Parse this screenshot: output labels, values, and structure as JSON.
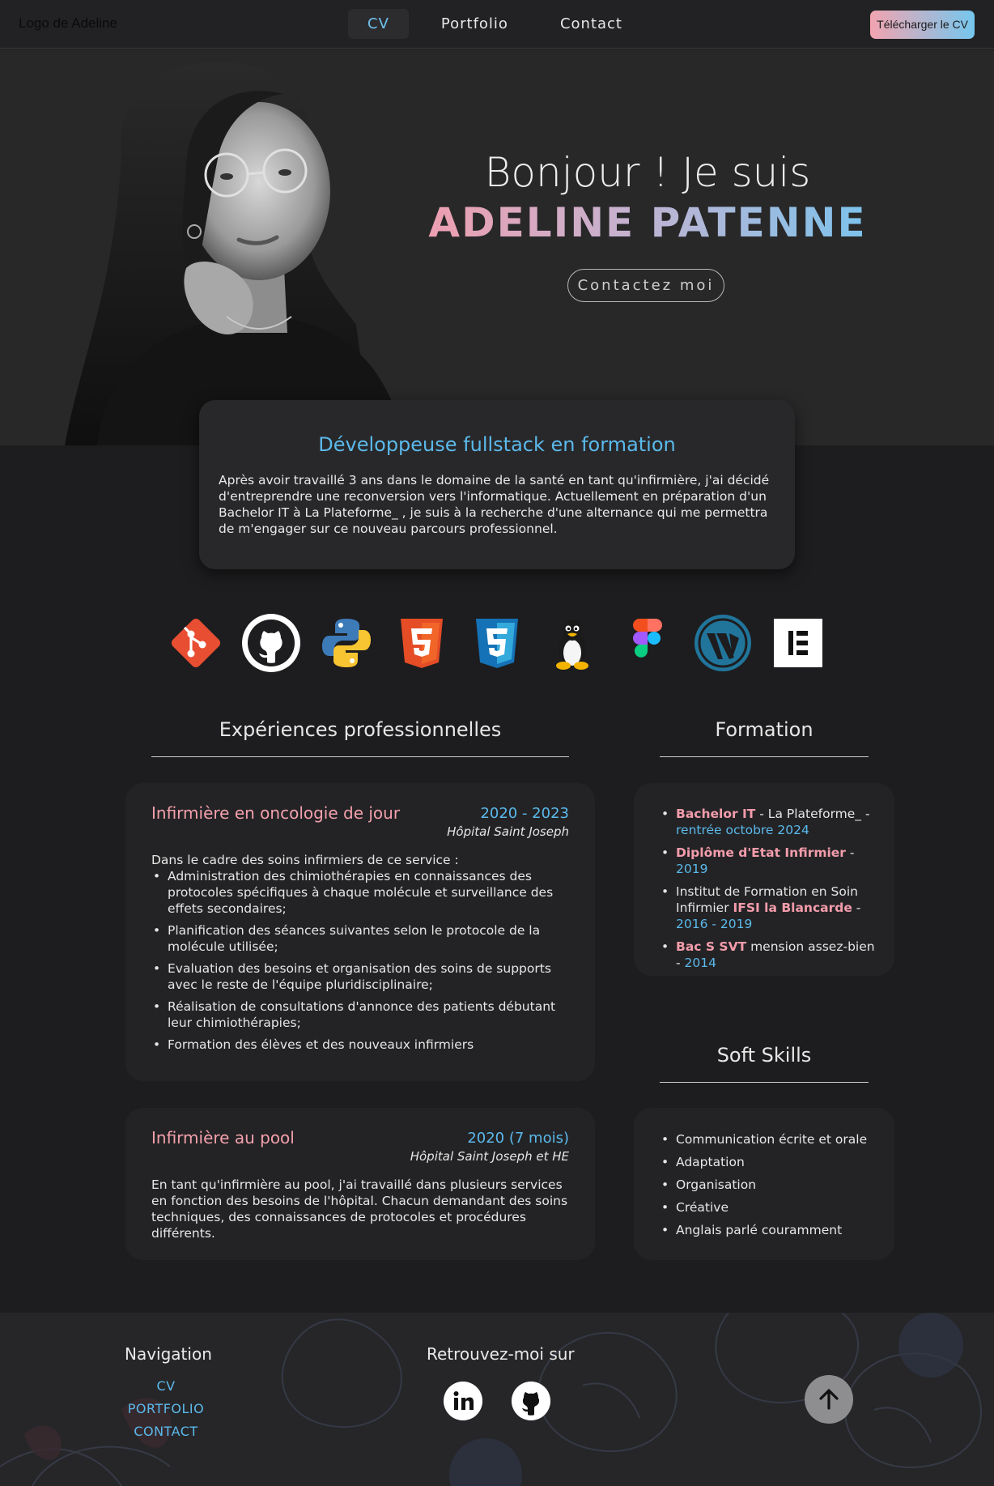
{
  "nav": {
    "logo": "Logo de Adeline",
    "links": [
      "CV",
      "Portfolio",
      "Contact"
    ],
    "download_cv": "Télécharger le CV"
  },
  "hero": {
    "greeting": "Bonjour ! Je suis",
    "name": "ADELINE PATENNE",
    "contact_button": "Contactez moi"
  },
  "intro": {
    "title": "Développeuse fullstack en formation",
    "text": "Après avoir travaillé 3 ans dans le domaine de la santé en tant qu'infirmière, j'ai décidé d'entreprendre une reconversion vers l'informatique. Actuellement en préparation d'un Bachelor IT à La Plateforme_ , je suis à la recherche d'une alternance qui me permettra de m'engager sur ce nouveau parcours professionnel."
  },
  "skills": [
    "git-icon",
    "github-icon",
    "python-icon",
    "html5-icon",
    "css3-icon",
    "linux-icon",
    "figma-icon",
    "wordpress-icon",
    "elementor-icon"
  ],
  "experiences": {
    "title": "Expériences professionnelles",
    "jobs": [
      {
        "title": "Infirmière en oncologie de jour",
        "dates": "2020 - 2023",
        "place": "Hôpital Saint Joseph",
        "intro": "Dans le cadre des soins infirmiers de ce service :",
        "tasks": [
          "Administration des chimiothérapies en connaissances des protocoles spécifiques à chaque molécule et surveillance des effets secondaires;",
          "Planification des séances suivantes selon le protocole de la molécule utilisée;",
          "Evaluation des besoins et organisation des soins de supports avec le reste de l'équipe pluridisciplinaire;",
          "Réalisation de consultations d'annonce des patients débutant leur chimiothérapies;",
          "Formation des élèves et des nouveaux infirmiers"
        ]
      },
      {
        "title": "Infirmière au pool",
        "dates": "2020 (7 mois)",
        "place": "Hôpital Saint Joseph et HE",
        "text": "En tant qu'infirmière au pool, j'ai travaillé dans plusieurs services en fonction des besoins de l'hôpital. Chacun demandant des soins techniques, des connaissances de protocoles et procédures différents."
      }
    ]
  },
  "formation": {
    "title": "Formation",
    "items": [
      {
        "a": "Bachelor IT",
        "b": " - La Plateforme_ - ",
        "c": "rentrée octobre 2024"
      },
      {
        "a": "Diplôme d'Etat Infirmier",
        "b": " - ",
        "c": "2019"
      },
      {
        "pre": "Institut de Formation en Soin Infirmier ",
        "a": "IFSI la Blancarde",
        "b": " - ",
        "c": "2016 - 2019"
      },
      {
        "a": "Bac S SVT",
        "b": " mension assez-bien - ",
        "c": "2014"
      }
    ]
  },
  "soft_skills": {
    "title": "Soft Skills",
    "items": [
      "Communication écrite et orale",
      "Adaptation",
      "Organisation",
      "Créative",
      "Anglais parlé couramment"
    ]
  },
  "footer": {
    "nav_title": "Navigation",
    "nav_links": [
      "CV",
      "PORTFOLIO",
      "CONTACT"
    ],
    "social_title": "Retrouvez-moi sur",
    "socials": [
      "linkedin-icon",
      "github-icon"
    ]
  },
  "colors": {
    "accent_blue": "#5bb9eb",
    "accent_pink": "#f39cab",
    "background": "#1d1d1f"
  }
}
